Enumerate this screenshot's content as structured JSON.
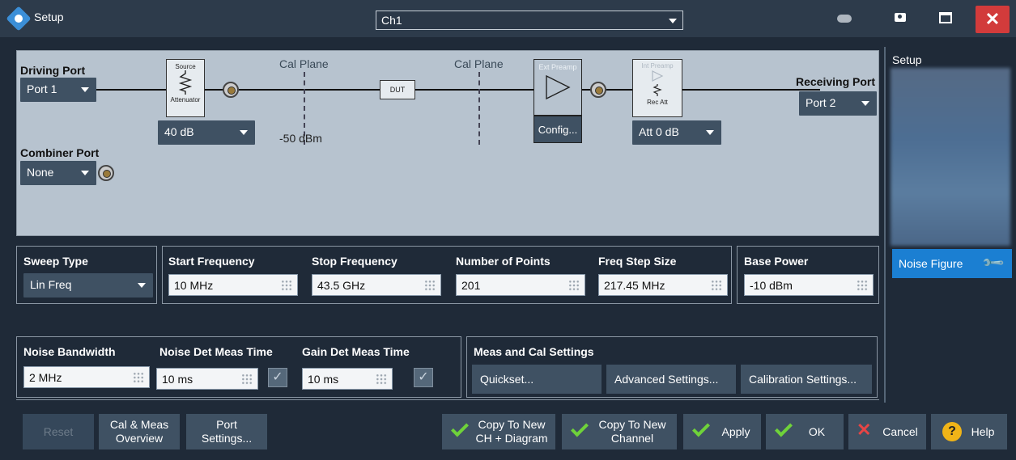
{
  "window": {
    "title": "Setup",
    "channel": "Ch1"
  },
  "diagram": {
    "driving_port_label": "Driving Port",
    "driving_port_value": "Port 1",
    "combiner_port_label": "Combiner Port",
    "combiner_port_value": "None",
    "source_label": "Source",
    "attenuator_label": "Attenuator",
    "source_att_value": "40 dB",
    "cal_plane_label": "Cal Plane",
    "cal_plane_2_label": "Cal Plane",
    "power_level": "-50 dBm",
    "dut_label": "DUT",
    "ext_preamp_label": "Ext Preamp",
    "config_label": "Config...",
    "int_preamp_label": "Int Preamp",
    "rec_att_label": "Rec Att",
    "rec_att_value": "Att 0 dB",
    "receiving_port_label": "Receiving Port",
    "receiving_port_value": "Port 2"
  },
  "side": {
    "title": "Setup",
    "noise_figure": "Noise Figure"
  },
  "sweep": {
    "sweep_type_label": "Sweep Type",
    "sweep_type_value": "Lin Freq",
    "start_label": "Start Frequency",
    "start_value": "10 MHz",
    "stop_label": "Stop Frequency",
    "stop_value": "43.5 GHz",
    "points_label": "Number of Points",
    "points_value": "201",
    "step_label": "Freq Step Size",
    "step_value": "217.45 MHz",
    "base_power_label": "Base Power",
    "base_power_value": "-10 dBm"
  },
  "noise": {
    "bandwidth_label": "Noise Bandwidth",
    "bandwidth_value": "2 MHz",
    "det_time_label": "Noise Det Meas Time",
    "det_time_value": "10 ms",
    "gain_time_label": "Gain Det Meas Time",
    "gain_time_value": "10 ms"
  },
  "meas": {
    "title": "Meas and Cal Settings",
    "quickset": "Quickset...",
    "advanced": "Advanced Settings...",
    "calibration": "Calibration Settings..."
  },
  "buttons": {
    "reset": "Reset",
    "cal_meas_1": "Cal & Meas",
    "cal_meas_2": "Overview",
    "port_1": "Port",
    "port_2": "Settings...",
    "copy_ch_diag_1": "Copy To New",
    "copy_ch_diag_2": "CH + Diagram",
    "copy_ch_1": "Copy To New",
    "copy_ch_2": "Channel",
    "apply": "Apply",
    "ok": "OK",
    "cancel": "Cancel",
    "help": "Help"
  },
  "colors": {
    "accent": "#1b7fd2",
    "close": "#d23b3b",
    "check": "#6fd23a",
    "diagram_bg": "#b7c3cf"
  }
}
